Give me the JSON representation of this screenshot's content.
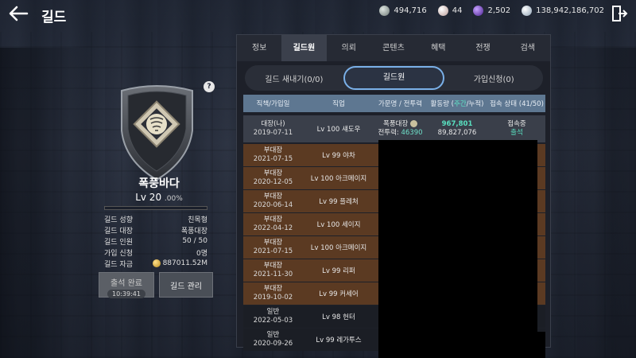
{
  "page": {
    "title": "길드"
  },
  "currencies": [
    {
      "icon": "silver-coin-icon",
      "value": "494,716",
      "color": "#9aa6a0"
    },
    {
      "icon": "pearl-icon",
      "value": "44",
      "color": "#d9c2bf"
    },
    {
      "icon": "purple-crystal-icon",
      "value": "2,502",
      "color": "#8a5ad8"
    },
    {
      "icon": "white-gem-icon",
      "value": "138,942,186,702",
      "color": "#d6dde6"
    }
  ],
  "guild": {
    "name": "폭풍바다",
    "level": "Lv 20",
    "level_pct": ".00%",
    "level_fraction": 0.0,
    "stats": [
      {
        "label": "길드 성향",
        "value": "친목형"
      },
      {
        "label": "길드 대장",
        "value": "폭풍대장"
      },
      {
        "label": "길드 인원",
        "value": "50 / 50"
      },
      {
        "label": "가입 신청",
        "value": "0명"
      },
      {
        "label": "길드 자금",
        "value": "887011.52M"
      }
    ],
    "attend_label": "출석 완료",
    "attend_time": "10:39:41",
    "manage_label": "길드 관리"
  },
  "tabs": [
    "정보",
    "길드원",
    "의뢰",
    "콘텐츠",
    "혜택",
    "전쟁",
    "검색"
  ],
  "active_tab": 1,
  "subtabs": [
    "길드 새내기(0/0)",
    "길드원",
    "가입신청(0)"
  ],
  "table": {
    "headers": [
      "직책/가입일",
      "직업",
      "가문명 / 전투력",
      "활동량 (",
      "주간",
      "/누적)",
      "접속 상태 (41/50)"
    ],
    "leader": {
      "rank": "대장(나)",
      "date": "2019-07-11",
      "class": "Lv 100 섀도우",
      "family": "폭풍대장",
      "cp_label": "전투력:",
      "cp": "46390",
      "weekly": "967,801",
      "total": "89,827,076",
      "status": "접속중",
      "status2": "출석"
    },
    "rows": [
      {
        "rank": "부대장",
        "date": "2021-07-15",
        "class": "Lv 99 야차",
        "type": "deputy"
      },
      {
        "rank": "부대장",
        "date": "2020-12-05",
        "class": "Lv 100 아크메이지",
        "type": "deputy"
      },
      {
        "rank": "부대장",
        "date": "2020-06-14",
        "class": "Lv 99 플레처",
        "type": "deputy"
      },
      {
        "rank": "부대장",
        "date": "2022-04-12",
        "class": "Lv 100 세이지",
        "type": "deputy"
      },
      {
        "rank": "부대장",
        "date": "2021-07-15",
        "class": "Lv 100 아크메이지",
        "type": "deputy"
      },
      {
        "rank": "부대장",
        "date": "2021-11-30",
        "class": "Lv 99 리퍼",
        "type": "deputy"
      },
      {
        "rank": "부대장",
        "date": "2019-10-02",
        "class": "Lv 99 커세어",
        "type": "deputy"
      },
      {
        "rank": "일반",
        "date": "2022-05-03",
        "class": "Lv 98 헌터",
        "type": "normal"
      },
      {
        "rank": "일반",
        "date": "2020-09-26",
        "class": "Lv 99 레가투스",
        "type": "normal"
      }
    ]
  }
}
